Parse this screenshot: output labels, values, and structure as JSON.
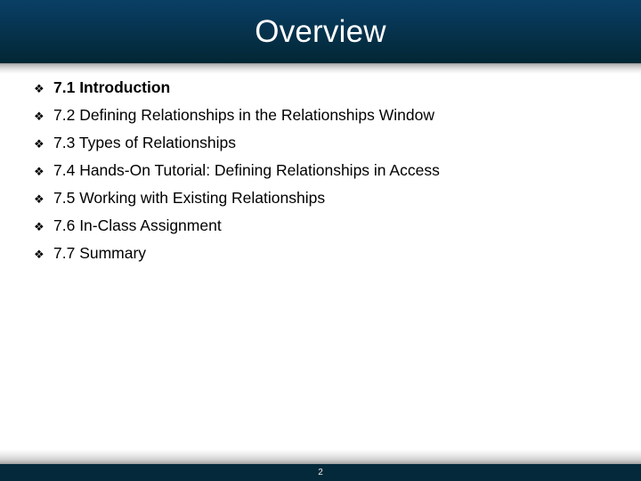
{
  "slide": {
    "title": "Overview",
    "page_number": "2",
    "bullet_glyph": "❖",
    "bullet_icon_name": "diamond-bullet-icon",
    "colors": {
      "header_top": "#0a3f64",
      "header_bottom": "#032734",
      "footer_bar": "#04293a",
      "title_text": "#ffffff",
      "body_text": "#000000",
      "background": "#ffffff"
    },
    "outline": [
      {
        "label": "7.1 Introduction",
        "bold": true
      },
      {
        "label": "7.2 Defining Relationships in the Relationships Window",
        "bold": false
      },
      {
        "label": "7.3 Types of Relationships",
        "bold": false
      },
      {
        "label": "7.4 Hands-On Tutorial: Defining Relationships in Access",
        "bold": false
      },
      {
        "label": "7.5 Working with Existing Relationships",
        "bold": false
      },
      {
        "label": "7.6 In-Class Assignment",
        "bold": false
      },
      {
        "label": "7.7 Summary",
        "bold": false
      }
    ]
  }
}
